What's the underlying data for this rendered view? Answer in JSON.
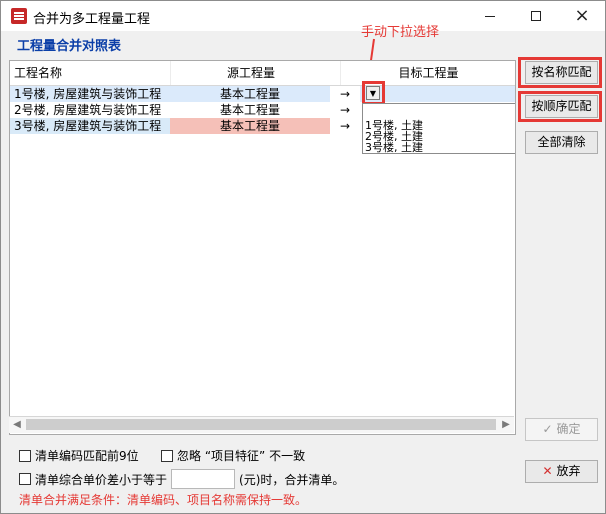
{
  "window": {
    "title": "合并为多工程量工程",
    "section_title": "工程量合并对照表",
    "callout": "手动下拉选择"
  },
  "table": {
    "headers": [
      "工程名称",
      "源工程量",
      "目标工程量"
    ],
    "rows": [
      {
        "name": "1号楼, 房屋建筑与装饰工程",
        "source": "基本工程量",
        "arrow": "→",
        "target": ""
      },
      {
        "name": "2号楼, 房屋建筑与装饰工程",
        "source": "基本工程量",
        "arrow": "→",
        "target": ""
      },
      {
        "name": "3号楼, 房屋建筑与装饰工程",
        "source": "基本工程量",
        "arrow": "→",
        "target": ""
      }
    ],
    "dropdown_options": [
      "1号楼, 土建",
      "2号楼, 土建",
      "3号楼, 土建"
    ]
  },
  "buttons": {
    "match_by_name": "按名称匹配",
    "match_by_order": "按顺序匹配",
    "clear_all": "全部清除",
    "confirm": "确定",
    "cancel": "放弃"
  },
  "options": {
    "match_code_prefix": "清单编码匹配前9位",
    "ignore_feature": "忽略 “项目特征” 不一致",
    "price_diff_prefix": "清单综合单价差小于等于",
    "price_diff_suffix": "(元)时，合并清单。",
    "price_diff_value": ""
  },
  "notice": "清单合并满足条件：清单编码、项目名称需保持一致。",
  "colors": {
    "accent_red": "#e53935",
    "title_blue": "#0b3fa8"
  }
}
